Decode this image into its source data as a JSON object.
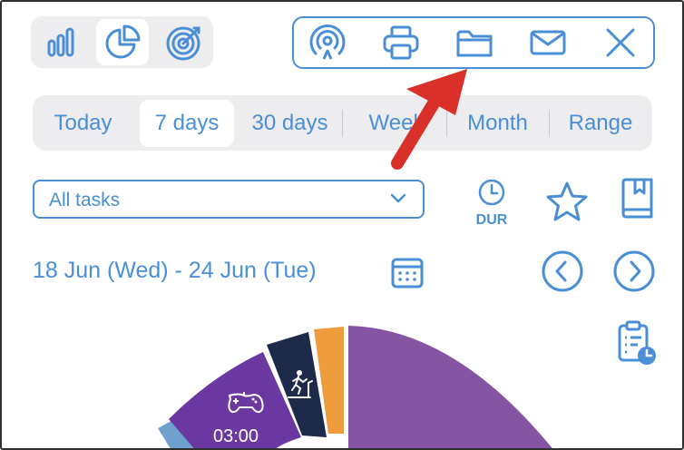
{
  "view_switcher": {
    "items": [
      {
        "icon": "bar-chart-icon",
        "selected": false
      },
      {
        "icon": "pie-chart-icon",
        "selected": true
      },
      {
        "icon": "target-icon",
        "selected": false
      }
    ]
  },
  "toolbar": {
    "icons": [
      "airdrop-icon",
      "printer-icon",
      "folder-icon",
      "mail-icon",
      "close-icon"
    ]
  },
  "range_tabs": {
    "items": [
      {
        "label": "Today",
        "selected": false
      },
      {
        "label": "7 days",
        "selected": true
      },
      {
        "label": "30 days",
        "selected": false
      },
      {
        "label": "Week",
        "selected": false
      },
      {
        "label": "Month",
        "selected": false
      },
      {
        "label": "Range",
        "selected": false
      }
    ]
  },
  "filter": {
    "value": "All tasks"
  },
  "duration_toggle": {
    "label": "DUR"
  },
  "date_range": {
    "label": "18 Jun (Wed) - 24 Jun (Tue)"
  },
  "chart_data": {
    "type": "pie",
    "slices": [
      {
        "icon": "gamepad-icon",
        "label": "03:00",
        "color": "#6b38a1"
      },
      {
        "icon": "treadmill-icon",
        "color": "#1e2a4a"
      },
      {
        "color": "#ef9d3c"
      },
      {
        "color": "#8554a3"
      }
    ]
  },
  "colors": {
    "accent": "#4a8fd6",
    "annotation_arrow": "#d9302a"
  }
}
